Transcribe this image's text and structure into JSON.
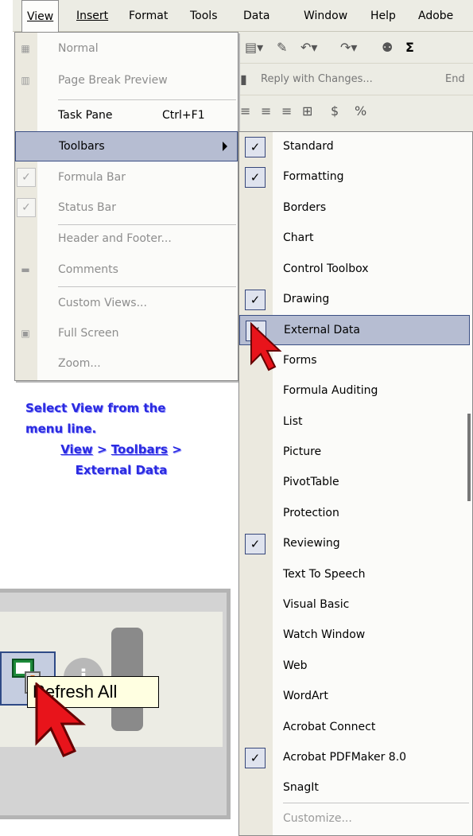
{
  "menubar": {
    "items": [
      {
        "label": "View"
      },
      {
        "label": "Insert"
      },
      {
        "label": "Format"
      },
      {
        "label": "Tools"
      },
      {
        "label": "Data"
      },
      {
        "label": "Window"
      },
      {
        "label": "Help"
      },
      {
        "label": "Adobe"
      }
    ]
  },
  "toolbar_fragment": {
    "reply_label": "Reply with Changes...",
    "end_label": "End",
    "sigma": "Σ",
    "currency": "$",
    "percent": "%"
  },
  "view_menu": {
    "normal": "Normal",
    "page_break": "Page Break Preview",
    "task_pane": "Task Pane",
    "task_pane_shortcut": "Ctrl+F1",
    "toolbars": "Toolbars",
    "formula_bar": "Formula Bar",
    "status_bar": "Status Bar",
    "header_footer": "Header and Footer...",
    "comments": "Comments",
    "custom_views": "Custom Views...",
    "full_screen": "Full Screen",
    "zoom": "Zoom..."
  },
  "toolbars_submenu": {
    "items": [
      {
        "label": "Standard",
        "checked": true
      },
      {
        "label": "Formatting",
        "checked": true
      },
      {
        "label": "Borders",
        "checked": false
      },
      {
        "label": "Chart",
        "checked": false
      },
      {
        "label": "Control Toolbox",
        "checked": false
      },
      {
        "label": "Drawing",
        "checked": true
      },
      {
        "label": "External Data",
        "checked": true
      },
      {
        "label": "Forms",
        "checked": false
      },
      {
        "label": "Formula Auditing",
        "checked": false
      },
      {
        "label": "List",
        "checked": false
      },
      {
        "label": "Picture",
        "checked": false
      },
      {
        "label": "PivotTable",
        "checked": false
      },
      {
        "label": "Protection",
        "checked": false
      },
      {
        "label": "Reviewing",
        "checked": true
      },
      {
        "label": "Text To Speech",
        "checked": false
      },
      {
        "label": "Visual Basic",
        "checked": false
      },
      {
        "label": "Watch Window",
        "checked": false
      },
      {
        "label": "Web",
        "checked": false
      },
      {
        "label": "WordArt",
        "checked": false
      },
      {
        "label": "Acrobat Connect",
        "checked": false
      },
      {
        "label": "Acrobat PDFMaker 8.0",
        "checked": true
      },
      {
        "label": "SnagIt",
        "checked": false
      }
    ],
    "customize": "Customize..."
  },
  "instructions": {
    "line1": "Select View from the",
    "line2": "menu line.",
    "line3_view": "View",
    "line3_sep1": ">",
    "line3_toolbars": "Toolbars",
    "line3_sep2": ">",
    "line4": "External Data"
  },
  "external_data_toolbar": {
    "tooltip": "Refresh All",
    "info_glyph": "i",
    "overflow_glyph": "▾"
  },
  "colors": {
    "menu_highlight": "#b6bdd2",
    "highlight_border": "#3b4f84",
    "instruction_text": "#2a2ae0",
    "tooltip_bg": "#ffffe1",
    "cursor": "#e8141b"
  }
}
